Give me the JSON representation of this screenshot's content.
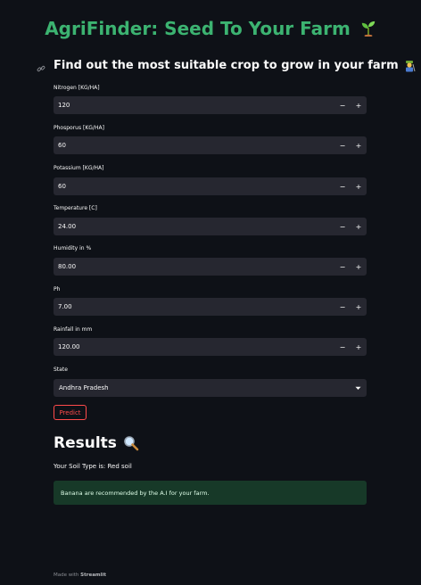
{
  "header": {
    "title": "AgriFinder: Seed To Your Farm",
    "subtitle": "Find out the most suitable crop to grow in your farm"
  },
  "form": {
    "fields": [
      {
        "label": "Nitrogen [KG/HA]",
        "value": "120"
      },
      {
        "label": "Phosporus [KG/HA]",
        "value": "60"
      },
      {
        "label": "Potassium [KG/HA]",
        "value": "60"
      },
      {
        "label": "Temperature [C]",
        "value": "24.00"
      },
      {
        "label": "Humidity in %",
        "value": "80.00"
      },
      {
        "label": "Ph",
        "value": "7.00"
      },
      {
        "label": "Rainfall in mm",
        "value": "120.00"
      }
    ],
    "stepper": {
      "minus": "−",
      "plus": "+"
    },
    "state_label": "State",
    "state_value": "Andhra Pradesh",
    "predict_label": "Predict"
  },
  "results": {
    "title": "Results",
    "soil_text": "Your Soil Type is: Red soil",
    "recommendation": "Banana are recommended by the A.I for your farm."
  },
  "footer": {
    "prefix": "Made with",
    "brand": "Streamlit"
  },
  "colors": {
    "background": "#0e1117",
    "title_green": "#3cb371",
    "input_bg": "#262730",
    "primary_red": "#ff4b4b",
    "success_bg": "#173928"
  },
  "icons": [
    "seedling-icon",
    "link-icon",
    "farmer-icon",
    "magnifier-icon",
    "chevron-down-icon"
  ]
}
